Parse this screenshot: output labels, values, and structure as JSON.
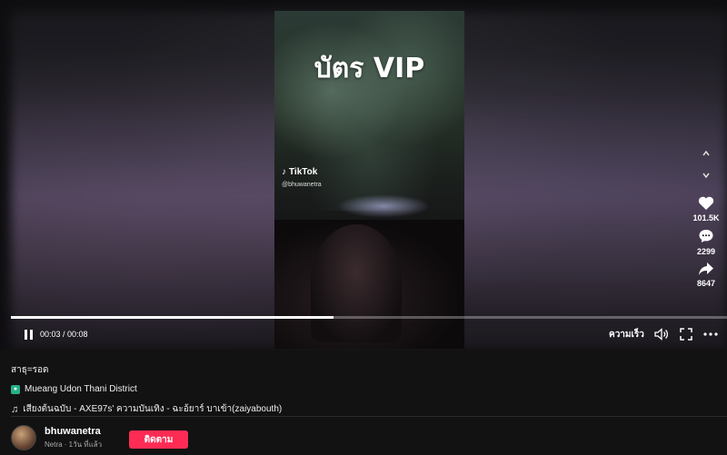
{
  "video": {
    "overlay_title": "บัตร VIP",
    "watermark_brand": "TikTok",
    "watermark_user": "@bhuwanetra"
  },
  "actions": {
    "likes": "101.5K",
    "comments": "2299",
    "shares": "8647"
  },
  "playback": {
    "time": "00:03 / 00:08",
    "progress_fraction": 0.45,
    "speed_label": "ความเร็ว"
  },
  "post": {
    "caption": "สาธุ=รอด",
    "location": "Mueang Udon Thani District",
    "music": "เสียงต้นฉบับ - AXE97s' ความบันเทิง - ฉะอ้ยาร์ บาเข้า(zaiyabouth)"
  },
  "author": {
    "username": "bhuwanetra",
    "subline": "Netra · 1วัน ที่แล้ว",
    "follow_label": "ติดตาม"
  },
  "colors": {
    "accent": "#fe2c55",
    "location_badge": "#27b089"
  }
}
